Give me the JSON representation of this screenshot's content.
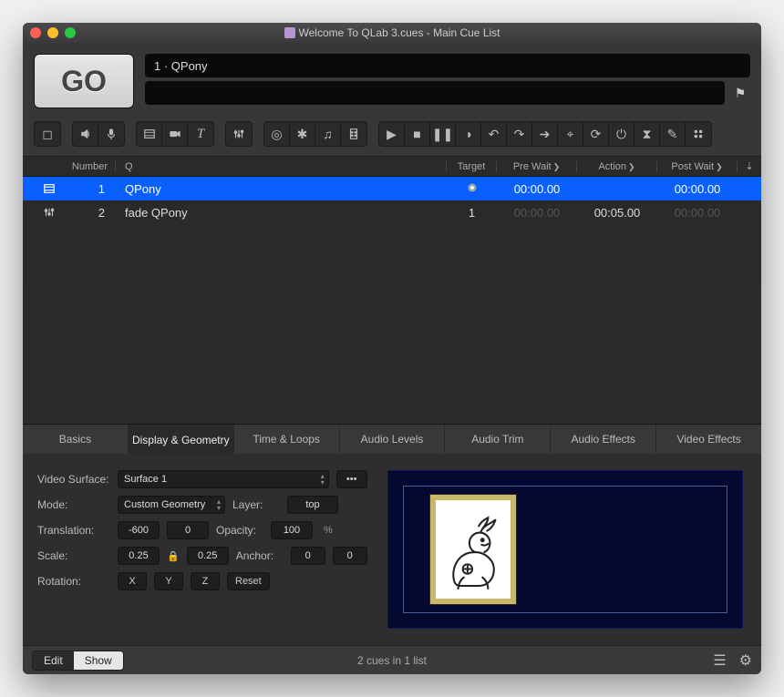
{
  "window": {
    "title": "Welcome To QLab 3.cues - Main Cue List"
  },
  "go": {
    "label": "GO"
  },
  "standby": {
    "cue_label": "1 · QPony"
  },
  "cue_headers": {
    "number": "Number",
    "q": "Q",
    "target": "Target",
    "prewait": "Pre Wait",
    "action": "Action",
    "postwait": "Post Wait"
  },
  "cues": [
    {
      "icon": "video",
      "number": "1",
      "name": "QPony",
      "target_icon": "target",
      "prewait": "00:00.00",
      "action": "",
      "postwait": "00:00.00",
      "selected": true
    },
    {
      "icon": "sliders",
      "number": "2",
      "name": "fade QPony",
      "target": "1",
      "prewait": "00:00.00",
      "action": "00:05.00",
      "postwait": "00:00.00",
      "selected": false
    }
  ],
  "tabs": [
    "Basics",
    "Display & Geometry",
    "Time & Loops",
    "Audio Levels",
    "Audio Trim",
    "Audio Effects",
    "Video Effects"
  ],
  "active_tab": "Display & Geometry",
  "inspector": {
    "labels": {
      "surface": "Video Surface:",
      "mode": "Mode:",
      "layer": "Layer:",
      "translation": "Translation:",
      "opacity": "Opacity:",
      "scale": "Scale:",
      "anchor": "Anchor:",
      "rotation": "Rotation:"
    },
    "surface": "Surface 1",
    "mode": "Custom Geometry",
    "layer": "top",
    "translation_x": "-600",
    "translation_y": "0",
    "opacity": "100",
    "scale_x": "0.25",
    "scale_y": "0.25",
    "anchor_x": "0",
    "anchor_y": "0",
    "rot_x": "X",
    "rot_y": "Y",
    "rot_z": "Z",
    "reset": "Reset"
  },
  "footer": {
    "edit": "Edit",
    "show": "Show",
    "status": "2 cues in 1 list"
  }
}
